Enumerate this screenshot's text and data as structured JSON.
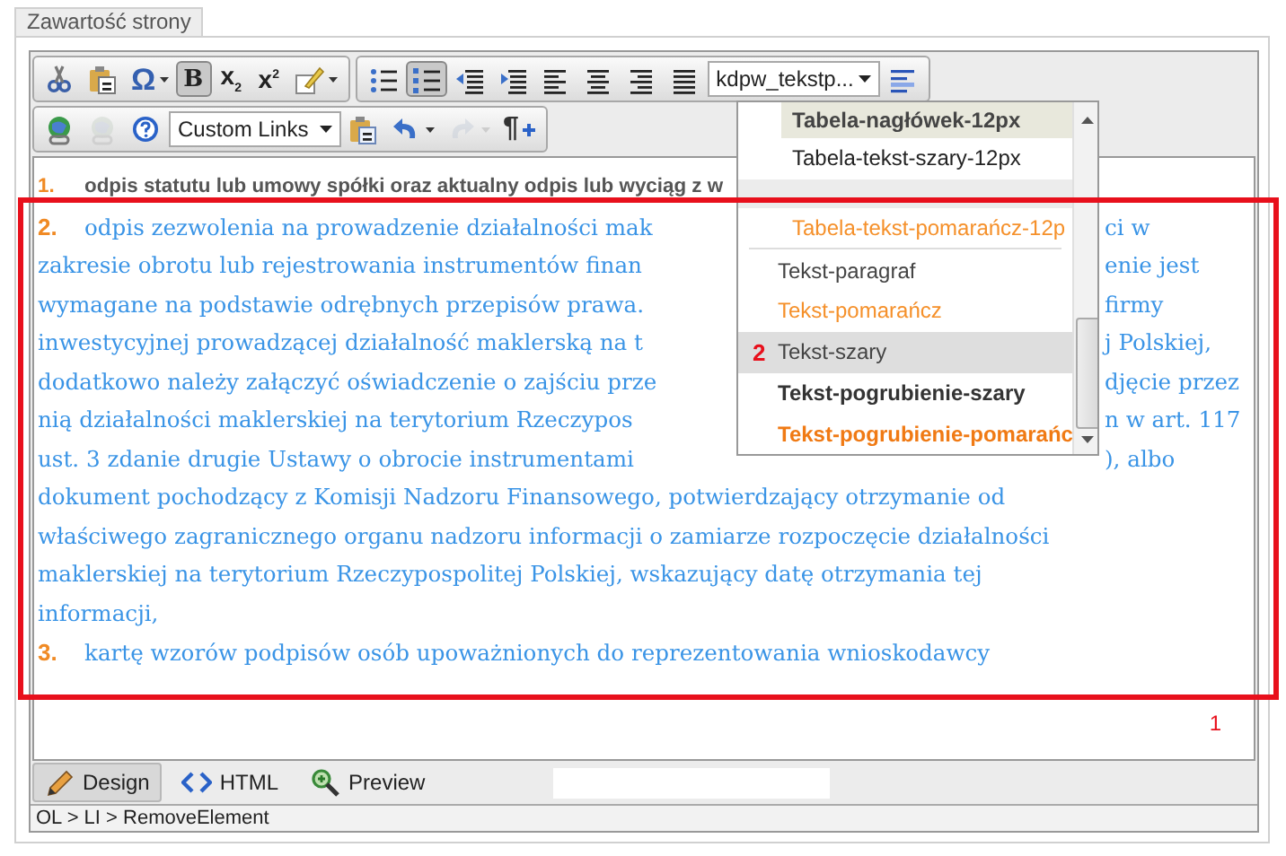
{
  "page_tab": {
    "label": "Zawartość strony"
  },
  "toolbar": {
    "rows": [
      {
        "groups": [
          {
            "items": [
              {
                "kind": "cut",
                "dropdown": false,
                "active": false,
                "disabled": false
              },
              {
                "kind": "paste",
                "dropdown": false,
                "active": false,
                "disabled": false
              },
              {
                "kind": "symbol",
                "dropdown": true,
                "label": "Ω",
                "active": false,
                "disabled": false
              },
              {
                "kind": "bold",
                "dropdown": false,
                "label": "B",
                "active": true,
                "disabled": false
              },
              {
                "kind": "subscript",
                "dropdown": false,
                "label": "x$_{2}$",
                "active": false,
                "disabled": false
              },
              {
                "kind": "superscript",
                "dropdown": false,
                "label": "x$^{2}$",
                "active": false,
                "disabled": false
              },
              {
                "kind": "format",
                "dropdown": true,
                "active": false,
                "disabled": false
              }
            ]
          },
          {
            "items": [
              {
                "kind": "bullets",
                "dropdown": false,
                "active": false,
                "disabled": false
              },
              {
                "kind": "numbering",
                "dropdown": false,
                "active": true,
                "disabled": false
              },
              {
                "kind": "outdent",
                "dropdown": false,
                "active": false,
                "disabled": false
              },
              {
                "kind": "indent",
                "dropdown": false,
                "active": false,
                "disabled": false
              },
              {
                "kind": "left",
                "dropdown": false,
                "active": false,
                "disabled": false
              },
              {
                "kind": "center",
                "dropdown": false,
                "active": false,
                "disabled": false
              },
              {
                "kind": "right",
                "dropdown": false,
                "active": false,
                "disabled": false
              },
              {
                "kind": "justify",
                "dropdown": false,
                "active": false,
                "disabled": false
              },
              {
                "kind": "select",
                "value": "kdpw_tekstp..."
              },
              {
                "kind": "styles",
                "dropdown": false,
                "active": false,
                "disabled": false
              }
            ]
          }
        ]
      },
      {
        "groups": [
          {
            "items": [
              {
                "kind": "link",
                "dropdown": false,
                "active": false,
                "disabled": false
              },
              {
                "kind": "unlink",
                "dropdown": false,
                "active": false,
                "disabled": true
              },
              {
                "kind": "help",
                "dropdown": false,
                "active": false,
                "disabled": false
              },
              {
                "kind": "select",
                "value": "Custom Links"
              },
              {
                "kind": "pasteword",
                "dropdown": false,
                "active": false,
                "disabled": false
              },
              {
                "kind": "undo",
                "dropdown": true,
                "active": false,
                "disabled": false
              },
              {
                "kind": "redo",
                "dropdown": true,
                "active": false,
                "disabled": true
              },
              {
                "kind": "paragraph",
                "dropdown": false,
                "label": "¶",
                "active": false,
                "disabled": false
              }
            ]
          }
        ]
      }
    ]
  },
  "content": {
    "items": [
      {
        "number": "1.",
        "kind": "gray",
        "lines": [
          {
            "left": "odpis statutu lub umowy spółki oraz aktualny odpis lub wyciąg z w"
          }
        ]
      },
      {
        "number": "2.",
        "kind": "blue",
        "lines": [
          {
            "left": "odpis zezwolenia na prowadzenie działalności mak",
            "right": "ci w"
          },
          {
            "left": "zakresie obrotu lub rejestrowania instrumentów finan",
            "right": "enie jest"
          },
          {
            "left": "wymagane na podstawie odrębnych przepisów prawa.",
            "right": "firmy"
          },
          {
            "left": "inwestycyjnej prowadzącej działalność maklerską na t",
            "right": "j Polskiej,"
          },
          {
            "left": "dodatkowo należy załączyć oświadczenie o zajściu prze",
            "right": "djęcie przez"
          },
          {
            "left": "nią działalności maklerskiej na terytorium Rzeczypos",
            "right": "n w art. 117"
          },
          {
            "left": "ust. 3 zdanie drugie Ustawy o obrocie instrumentami",
            "right": "), albo"
          },
          {
            "full": "dokument pochodzący z Komisji Nadzoru Finansowego, potwierdzający otrzymanie od"
          },
          {
            "full": "właściwego zagranicznego organu nadzoru informacji o zamiarze rozpoczęcie działalności"
          },
          {
            "full": "maklerskiej na terytorium Rzeczypospolitej Polskiej, wskazujący datę otrzymania tej"
          },
          {
            "full": "informacji,"
          }
        ]
      },
      {
        "number": "3.",
        "kind": "blue",
        "lines": [
          {
            "full": "kartę wzorów podpisów osób upoważnionych do reprezentowania wnioskodawcy"
          }
        ]
      }
    ]
  },
  "style_dropdown": {
    "items": [
      {
        "label": "Tabela-nagłówek-12px",
        "kind": "table-header",
        "selected": true,
        "hovered": false
      },
      {
        "label": "Tabela-tekst-szary-12px",
        "kind": "plain",
        "selected": false,
        "hovered": false
      },
      {
        "kind": "blank",
        "selected": false,
        "hovered": false
      },
      {
        "label": "Tabela-tekst-pomarańcz-12p",
        "kind": "orange",
        "selected": false,
        "hovered": false
      },
      {
        "label": "Tekst-paragraf",
        "kind": "gray",
        "selected": false,
        "hovered": false
      },
      {
        "label": "Tekst-pomarańcz",
        "kind": "orange",
        "selected": false,
        "hovered": false
      },
      {
        "label": "Tekst-szary",
        "kind": "gray",
        "selected": false,
        "hovered": true,
        "marker": "2"
      },
      {
        "label": "Tekst-pogrubienie-szary",
        "kind": "bold-gray",
        "selected": false,
        "hovered": false
      },
      {
        "label": "Tekst-pogrubienie-pomarańc",
        "kind": "bold-orange",
        "selected": false,
        "hovered": false
      }
    ]
  },
  "annotation": {
    "label": "1"
  },
  "mode_tabs": [
    {
      "label": "Design",
      "selected": true
    },
    {
      "label": "HTML",
      "selected": false
    },
    {
      "label": "Preview",
      "selected": false
    }
  ],
  "status_bar": {
    "path": "OL > LI > RemoveElement"
  }
}
